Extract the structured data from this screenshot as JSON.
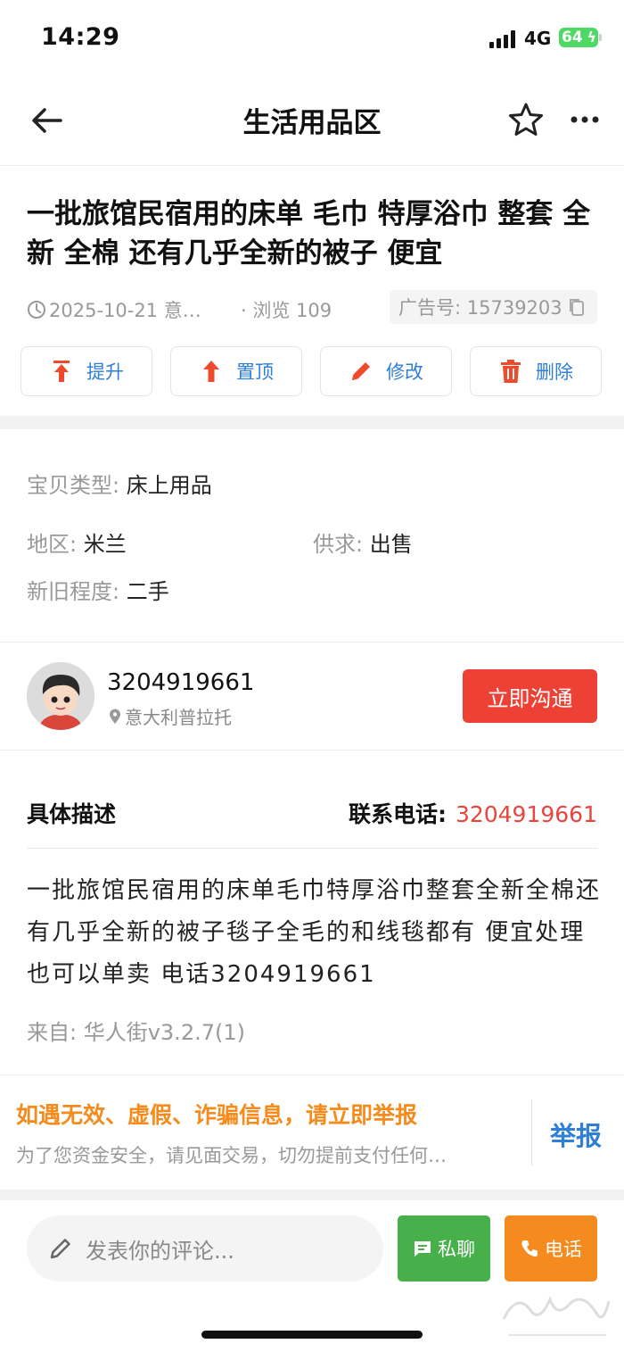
{
  "status_bar": {
    "time": "14:29",
    "network": "4G",
    "battery": "64"
  },
  "header": {
    "title": "生活用品区"
  },
  "post": {
    "title": "一批旅馆民宿用的床单 毛巾 特厚浴巾 整套 全新 全棉 还有几乎全新的被子 便宜",
    "date": "2025-10-21 意…",
    "views": "· 浏览 109",
    "ad_number": "广告号: 15739203"
  },
  "actions": [
    {
      "label": "提升",
      "icon": "boost-icon"
    },
    {
      "label": "置顶",
      "icon": "pin-top-icon"
    },
    {
      "label": "修改",
      "icon": "pencil-icon"
    },
    {
      "label": "删除",
      "icon": "trash-icon"
    }
  ],
  "attributes": {
    "type_label": "宝贝类型:",
    "type_value": "床上用品",
    "region_label": "地区:",
    "region_value": "米兰",
    "supply_label": "供求:",
    "supply_value": "出售",
    "condition_label": "新旧程度:",
    "condition_value": "二手"
  },
  "seller": {
    "name": "3204919661",
    "location": "意大利普拉托",
    "chat_button": "立即沟通"
  },
  "description": {
    "heading": "具体描述",
    "phone_label": "联系电话:",
    "phone": "3204919661",
    "text": "一批旅馆民宿用的床单毛巾特厚浴巾整套全新全棉还有几乎全新的被子毯子全毛的和线毯都有 便宜处理 也可以单卖 电话3204919661",
    "source": "来自: 华人街v3.2.7(1)"
  },
  "report": {
    "warning": "如遇无效、虚假、诈骗信息，请立即举报",
    "sub": "为了您资金安全，请见面交易，切勿提前支付任何…",
    "button": "举报"
  },
  "bottom_bar": {
    "comment_placeholder": "发表你的评论...",
    "pm_label": "私聊",
    "call_label": "电话"
  },
  "colors": {
    "accent_blue": "#2f7fd6",
    "red": "#ee4135",
    "green": "#47b04b",
    "orange": "#f58a1f"
  }
}
